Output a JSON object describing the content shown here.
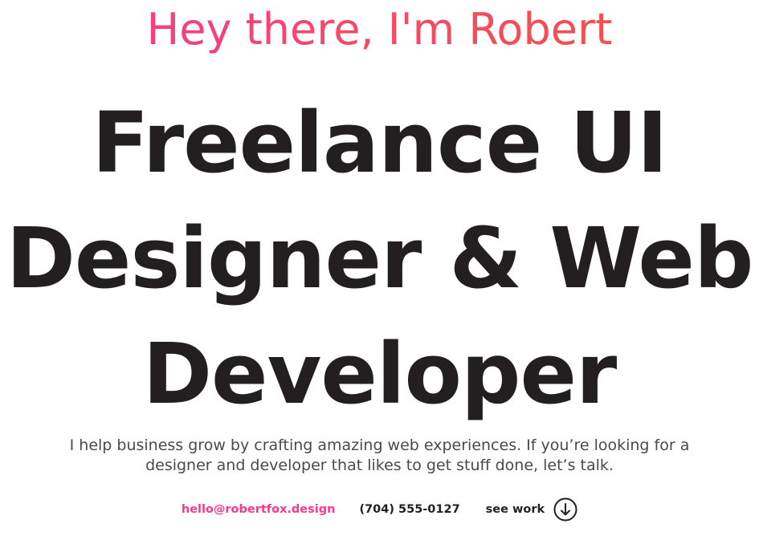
{
  "hero": {
    "greeting": "Hey there, I'm Robert",
    "headline_lines": [
      "Freelance UI",
      "Designer & Web",
      "Developer"
    ],
    "intro_line_1": "I help business grow by crafting amazing web experiences. If you’re looking for a",
    "intro_line_2": "designer and developer that likes to get stuff done, let’s talk."
  },
  "contact": {
    "email": "hello@robertfox.design",
    "phone": "(704) 555-0127",
    "see_work_label": "see work",
    "see_work_icon": "arrow-down-circle-icon"
  },
  "colors": {
    "accent_pink": "#f9388f",
    "accent_orange": "#f5533d",
    "text_dark": "#231f20",
    "text_body": "#4a4a4a"
  }
}
